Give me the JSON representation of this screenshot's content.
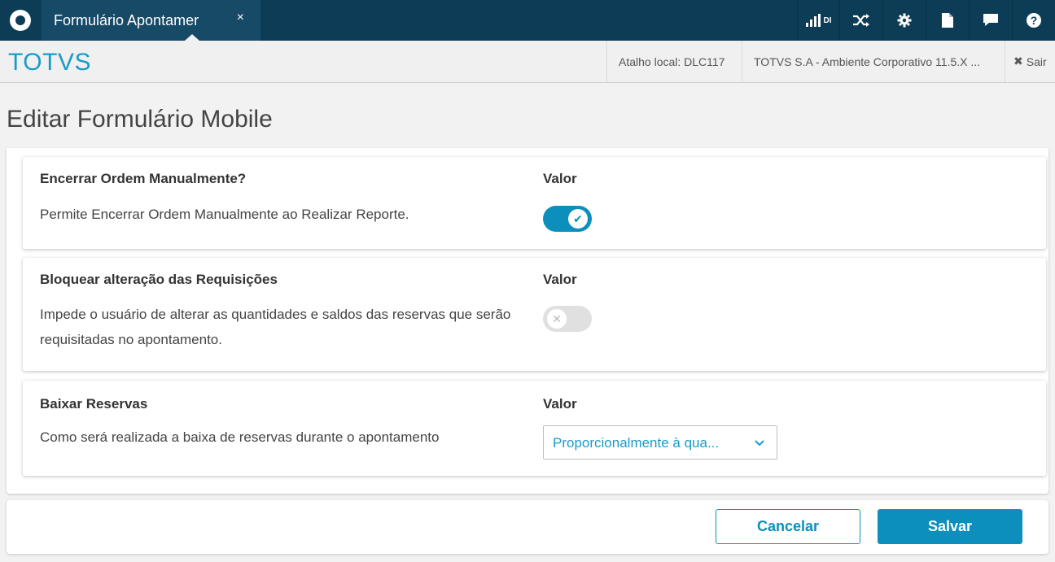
{
  "topbar": {
    "tab_title": "Formulário Apontamer",
    "tab_close": "×",
    "signal_label": "DI",
    "icons": [
      "signal-icon",
      "shuffle-icon",
      "gear-icon",
      "document-icon",
      "chat-icon",
      "help-icon"
    ]
  },
  "header": {
    "brand": "TOTVS",
    "shortcut": "Atalho local: DLC117",
    "environment": "TOTVS S.A - Ambiente Corporativo 11.5.X ...",
    "logout": "Sair"
  },
  "page": {
    "title": "Editar Formulário Mobile"
  },
  "cards": [
    {
      "title": "Encerrar Ordem Manualmente?",
      "description": "Permite Encerrar Ordem Manualmente ao Realizar Reporte.",
      "value_label": "Valor",
      "toggle_on": true
    },
    {
      "title": "Bloquear alteração das Requisições",
      "description": "Impede o usuário de alterar as quantidades e saldos das reservas que serão requisitadas no apontamento.",
      "value_label": "Valor",
      "toggle_on": false
    },
    {
      "title": "Baixar Reservas",
      "description": "Como será realizada a baixa de reservas durante o apontamento",
      "value_label": "Valor",
      "select_value": "Proporcionalmente à qua..."
    }
  ],
  "footer": {
    "cancel_label": "Cancelar",
    "save_label": "Salvar"
  },
  "colors": {
    "topbar": "#0c3c56",
    "accent": "#0c8fbd",
    "brand": "#1a9bc8"
  }
}
